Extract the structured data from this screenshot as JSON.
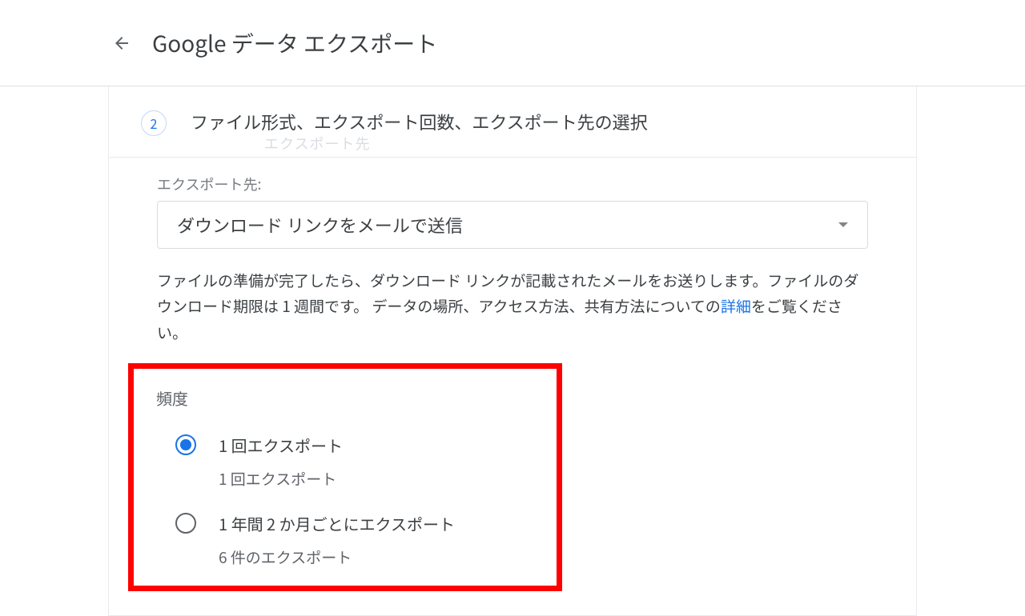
{
  "header": {
    "title": "Google データ エクスポート"
  },
  "step": {
    "number": "2",
    "title": "ファイル形式、エクスポート回数、エクスポート先の選択",
    "ghost": "エクスポート先"
  },
  "destination": {
    "label": "エクスポート先:",
    "value": "ダウンロード リンクをメールで送信"
  },
  "description": {
    "text1": "ファイルの準備が完了したら、ダウンロード リンクが記載されたメールをお送りします。ファイルのダウンロード期限は 1 週間です。 データの場所、アクセス方法、共有方法についての",
    "link": "詳細",
    "text2": "をご覧ください。"
  },
  "frequency": {
    "label": "頻度",
    "options": [
      {
        "label": "1 回エクスポート",
        "sublabel": "1 回エクスポート",
        "selected": true
      },
      {
        "label": "1 年間 2 か月ごとにエクスポート",
        "sublabel": "6 件のエクスポート",
        "selected": false
      }
    ]
  }
}
